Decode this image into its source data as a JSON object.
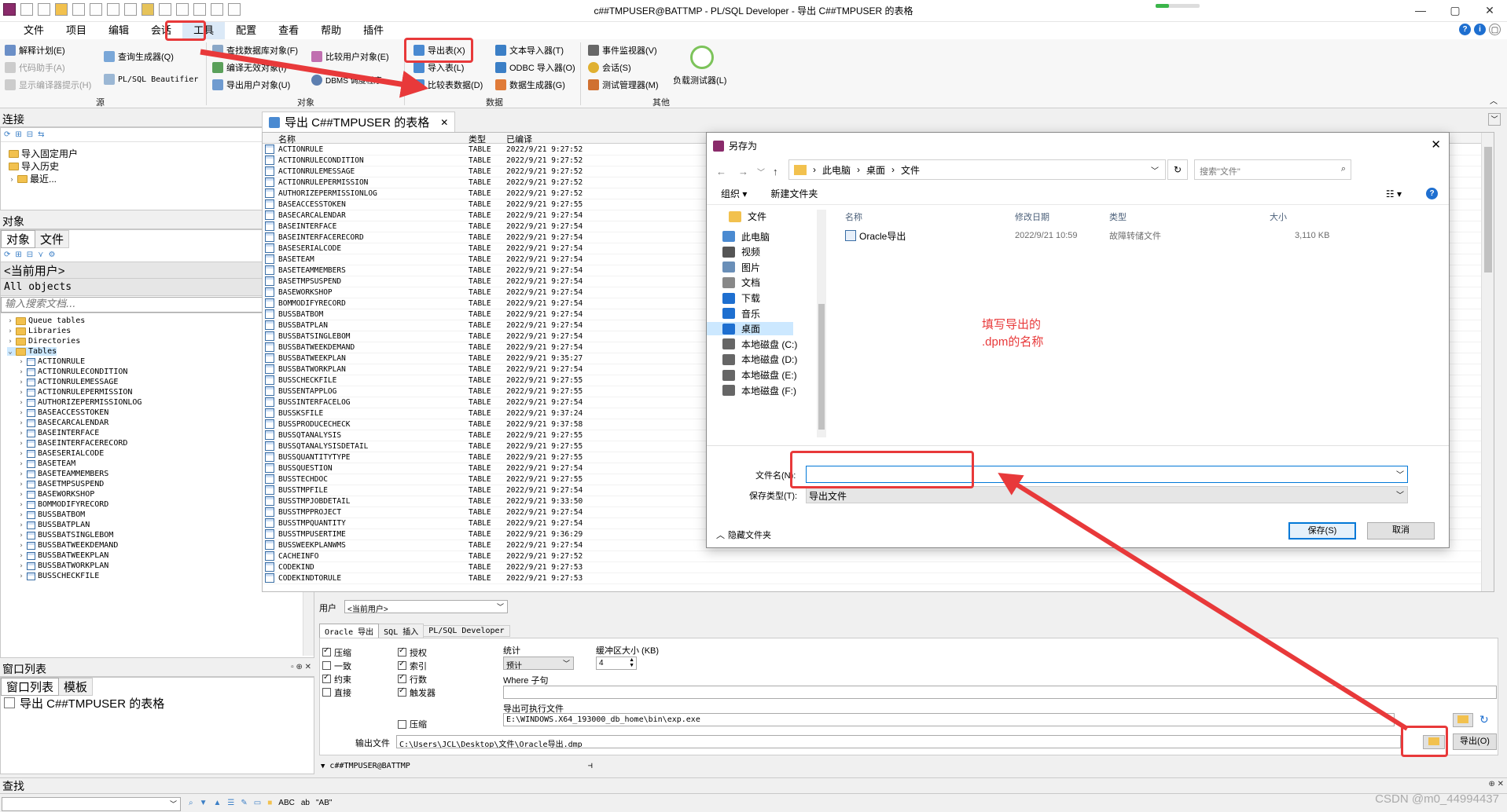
{
  "window": {
    "title": "c##TMPUSER@BATTMP - PL/SQL Developer - 导出 C##TMPUSER 的表格",
    "min": "—",
    "max": "▢",
    "close": "✕"
  },
  "menu": [
    "文件",
    "项目",
    "编辑",
    "会话",
    "工具",
    "配置",
    "查看",
    "帮助",
    "插件"
  ],
  "ribbon": {
    "source": {
      "items": [
        "解释计划(E)",
        "代码助手(A)",
        "显示编译器提示(H)",
        "查询生成器(Q)",
        "PL/SQL Beautifier"
      ],
      "label": "源"
    },
    "objects": {
      "items": [
        "查找数据库对象(F)",
        "编译无效对象(I)",
        "导出用户对象(U)",
        "比较用户对象(E)",
        "DBMS 调度程序"
      ],
      "label": "对象"
    },
    "data": {
      "items": [
        "导出表(X)",
        "导入表(L)",
        "比较表数据(D)",
        "文本导入器(T)",
        "ODBC 导入器(O)",
        "数据生成器(G)"
      ],
      "label": "数据"
    },
    "other": {
      "items": [
        "事件监视器(V)",
        "会话(S)",
        "测试管理器(M)",
        "负载测试器(L)"
      ],
      "label": "其他"
    }
  },
  "left": {
    "connections": {
      "title": "连接",
      "items": [
        "导入固定用户",
        "导入历史",
        "最近..."
      ]
    },
    "objects": {
      "title": "对象",
      "tabs": [
        "对象",
        "文件"
      ],
      "user": "<当前用户>",
      "filter": "All objects",
      "search_placeholder": "输入搜索文档...",
      "folders": [
        "Queue tables",
        "Libraries",
        "Directories",
        "Tables"
      ],
      "tables": [
        "ACTIONRULE",
        "ACTIONRULECONDITION",
        "ACTIONRULEMESSAGE",
        "ACTIONRULEPERMISSION",
        "AUTHORIZEPERMISSIONLOG",
        "BASEACCESSTOKEN",
        "BASECARCALENDAR",
        "BASEINTERFACE",
        "BASEINTERFACERECORD",
        "BASESERIALCODE",
        "BASETEAM",
        "BASETEAMMEMBERS",
        "BASETMPSUSPEND",
        "BASEWORKSHOP",
        "BOMMODIFYRECORD",
        "BUSSBATBOM",
        "BUSSBATPLAN",
        "BUSSBATSINGLEBOM",
        "BUSSBATWEEKDEMAND",
        "BUSSBATWEEKPLAN",
        "BUSSBATWORKPLAN",
        "BUSSCHECKFILE"
      ]
    },
    "windows": {
      "title": "窗口列表",
      "tabs": [
        "窗口列表",
        "模板"
      ],
      "item": "导出 C##TMPUSER 的表格"
    },
    "find": {
      "title": "查找"
    }
  },
  "doc": {
    "tab_title": "导出 C##TMPUSER 的表格",
    "columns": [
      "名称",
      "类型",
      "已编译"
    ],
    "rows": [
      [
        "ACTIONRULE",
        "TABLE",
        "2022/9/21 9:27:52"
      ],
      [
        "ACTIONRULECONDITION",
        "TABLE",
        "2022/9/21 9:27:52"
      ],
      [
        "ACTIONRULEMESSAGE",
        "TABLE",
        "2022/9/21 9:27:52"
      ],
      [
        "ACTIONRULEPERMISSION",
        "TABLE",
        "2022/9/21 9:27:52"
      ],
      [
        "AUTHORIZEPERMISSIONLOG",
        "TABLE",
        "2022/9/21 9:27:52"
      ],
      [
        "BASEACCESSTOKEN",
        "TABLE",
        "2022/9/21 9:27:55"
      ],
      [
        "BASECARCALENDAR",
        "TABLE",
        "2022/9/21 9:27:54"
      ],
      [
        "BASEINTERFACE",
        "TABLE",
        "2022/9/21 9:27:54"
      ],
      [
        "BASEINTERFACERECORD",
        "TABLE",
        "2022/9/21 9:27:54"
      ],
      [
        "BASESERIALCODE",
        "TABLE",
        "2022/9/21 9:27:54"
      ],
      [
        "BASETEAM",
        "TABLE",
        "2022/9/21 9:27:54"
      ],
      [
        "BASETEAMMEMBERS",
        "TABLE",
        "2022/9/21 9:27:54"
      ],
      [
        "BASETMPSUSPEND",
        "TABLE",
        "2022/9/21 9:27:54"
      ],
      [
        "BASEWORKSHOP",
        "TABLE",
        "2022/9/21 9:27:54"
      ],
      [
        "BOMMODIFYRECORD",
        "TABLE",
        "2022/9/21 9:27:54"
      ],
      [
        "BUSSBATBOM",
        "TABLE",
        "2022/9/21 9:27:54"
      ],
      [
        "BUSSBATPLAN",
        "TABLE",
        "2022/9/21 9:27:54"
      ],
      [
        "BUSSBATSINGLEBOM",
        "TABLE",
        "2022/9/21 9:27:54"
      ],
      [
        "BUSSBATWEEKDEMAND",
        "TABLE",
        "2022/9/21 9:27:54"
      ],
      [
        "BUSSBATWEEKPLAN",
        "TABLE",
        "2022/9/21 9:35:27"
      ],
      [
        "BUSSBATWORKPLAN",
        "TABLE",
        "2022/9/21 9:27:54"
      ],
      [
        "BUSSCHECKFILE",
        "TABLE",
        "2022/9/21 9:27:55"
      ],
      [
        "BUSSENTAPPLOG",
        "TABLE",
        "2022/9/21 9:27:55"
      ],
      [
        "BUSSINTERFACELOG",
        "TABLE",
        "2022/9/21 9:27:54"
      ],
      [
        "BUSSKSFILE",
        "TABLE",
        "2022/9/21 9:37:24"
      ],
      [
        "BUSSPRODUCECHECK",
        "TABLE",
        "2022/9/21 9:37:58"
      ],
      [
        "BUSSQTANALYSIS",
        "TABLE",
        "2022/9/21 9:27:55"
      ],
      [
        "BUSSQTANALYSISDETAIL",
        "TABLE",
        "2022/9/21 9:27:55"
      ],
      [
        "BUSSQUANTITYTYPE",
        "TABLE",
        "2022/9/21 9:27:55"
      ],
      [
        "BUSSQUESTION",
        "TABLE",
        "2022/9/21 9:27:54"
      ],
      [
        "BUSSTECHDOC",
        "TABLE",
        "2022/9/21 9:27:55"
      ],
      [
        "BUSSTMPFILE",
        "TABLE",
        "2022/9/21 9:27:54"
      ],
      [
        "BUSSTMPJOBDETAIL",
        "TABLE",
        "2022/9/21 9:33:50"
      ],
      [
        "BUSSTMPPROJECT",
        "TABLE",
        "2022/9/21 9:27:54"
      ],
      [
        "BUSSTMPQUANTITY",
        "TABLE",
        "2022/9/21 9:27:54"
      ],
      [
        "BUSSTMPUSERTIME",
        "TABLE",
        "2022/9/21 9:36:29"
      ],
      [
        "BUSSWEEKPLANWMS",
        "TABLE",
        "2022/9/21 9:27:54"
      ],
      [
        "CACHEINFO",
        "TABLE",
        "2022/9/21 9:27:52"
      ],
      [
        "CODEKIND",
        "TABLE",
        "2022/9/21 9:27:53"
      ],
      [
        "CODEKINDTORULE",
        "TABLE",
        "2022/9/21 9:27:53"
      ]
    ],
    "user_label": "用户",
    "user_value": "<当前用户>",
    "export_tabs": [
      "Oracle 导出",
      "SQL 插入",
      "PL/SQL Developer"
    ],
    "options_col1": [
      [
        "压缩",
        true
      ],
      [
        "一致",
        false
      ],
      [
        "约束",
        true
      ],
      [
        "直接",
        false
      ]
    ],
    "options_col2": [
      [
        "授权",
        true
      ],
      [
        "索引",
        true
      ],
      [
        "行数",
        true
      ],
      [
        "触发器",
        true
      ]
    ],
    "compress2": "压缩",
    "stats_label": "统计",
    "stats_value": "预计",
    "buffer_label": "缓冲区大小 (KB)",
    "buffer_value": "4",
    "where_label": "Where 子句",
    "exe_label": "导出可执行文件",
    "exe_value": "E:\\WINDOWS.X64_193000_db_home\\bin\\exp.exe",
    "output_label": "输出文件",
    "output_value": "C:\\Users\\JCL\\Desktop\\文件\\Oracle导出.dmp",
    "export_button": "导出(O)",
    "footer_conn": "c##TMPUSER@BATTMP"
  },
  "dialog": {
    "title": "另存为",
    "breadcrumb": [
      "此电脑",
      "桌面",
      "文件"
    ],
    "search_placeholder": "搜索\"文件\"",
    "organize": "组织 ▾",
    "new_folder": "新建文件夹",
    "sidebar": [
      "文件",
      "此电脑",
      "视频",
      "图片",
      "文档",
      "下载",
      "音乐",
      "桌面",
      "本地磁盘 (C:)",
      "本地磁盘 (D:)",
      "本地磁盘 (E:)",
      "本地磁盘 (F:)"
    ],
    "columns": [
      "名称",
      "修改日期",
      "类型",
      "大小"
    ],
    "file": {
      "name": "Oracle导出",
      "date": "2022/9/21 10:59",
      "type": "故障转储文件",
      "size": "3,110 KB"
    },
    "filename_label": "文件名(N):",
    "filename_value": "",
    "type_label": "保存类型(T):",
    "type_value": "导出文件",
    "hide_folders": "隐藏文件夹",
    "save": "保存(S)",
    "cancel": "取消"
  },
  "annotation": {
    "line1": "填写导出的",
    "line2": ".dpm的名称"
  },
  "watermark": "CSDN @m0_44994437",
  "colors": {
    "accent": "#e8393a",
    "select": "#cce8ff",
    "link": "#1e6fd0"
  }
}
